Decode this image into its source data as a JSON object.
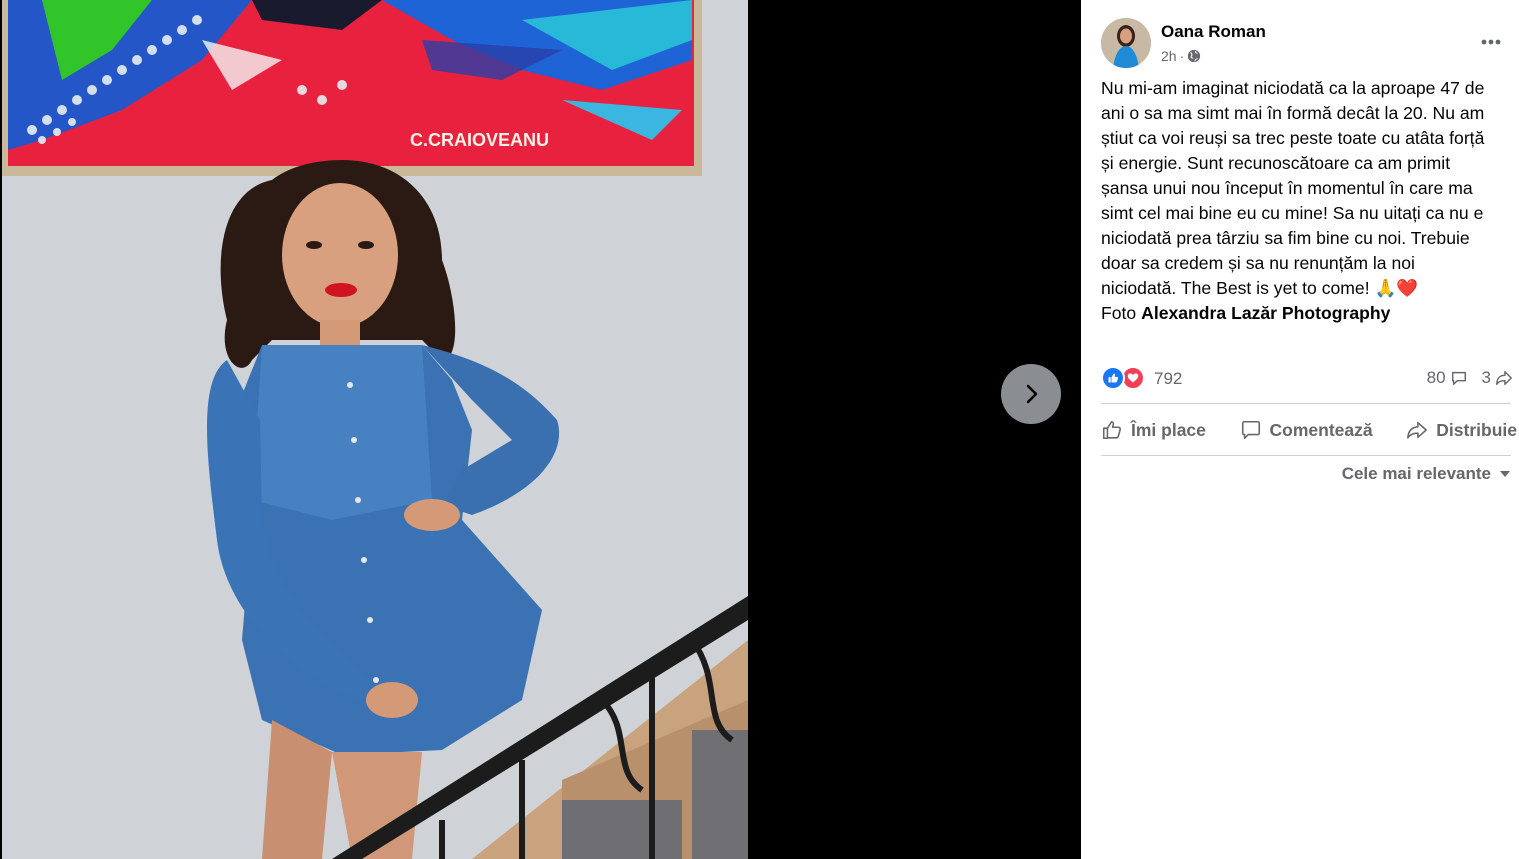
{
  "post": {
    "author": "Oana Roman",
    "time": "2h",
    "separator": "·",
    "text_lines": [
      "Nu mi-am imaginat niciodată ca la aproape 47 de",
      "ani o sa ma simt mai în formă decât la 20. Nu am",
      "știut ca voi reuși sa trec peste toate cu atâta forță",
      "și energie. Sunt recunoscătoare ca am primit",
      "șansa unui nou început în momentul în care ma",
      "simt cel mai bine eu cu mine! Sa nu uitați ca nu e",
      "niciodată prea târziu sa fim bine cu noi. Trebuie",
      "doar sa credem și sa nu renunțăm la noi",
      "niciodată. The Best is yet to come! 🙏❤️"
    ],
    "credit_prefix": "Foto",
    "credit_name": "Alexandra Lazăr Photography"
  },
  "stats": {
    "reactions": "792",
    "comments": "80",
    "shares": "3"
  },
  "actions": {
    "like": "Îmi place",
    "comment": "Comentează",
    "share": "Distribuie"
  },
  "sort_label": "Cele mai relevante",
  "painting_signature": "C.CRAIOVEANU",
  "icons": {
    "next": "chevron-right-icon",
    "more": "more-horizontal-icon",
    "privacy": "globe-icon",
    "like_reaction": "thumbs-up-icon",
    "love_reaction": "heart-icon"
  },
  "colors": {
    "like_blue": "#1877f2",
    "love_red": "#f33e58",
    "secondary_text": "#65676b"
  }
}
